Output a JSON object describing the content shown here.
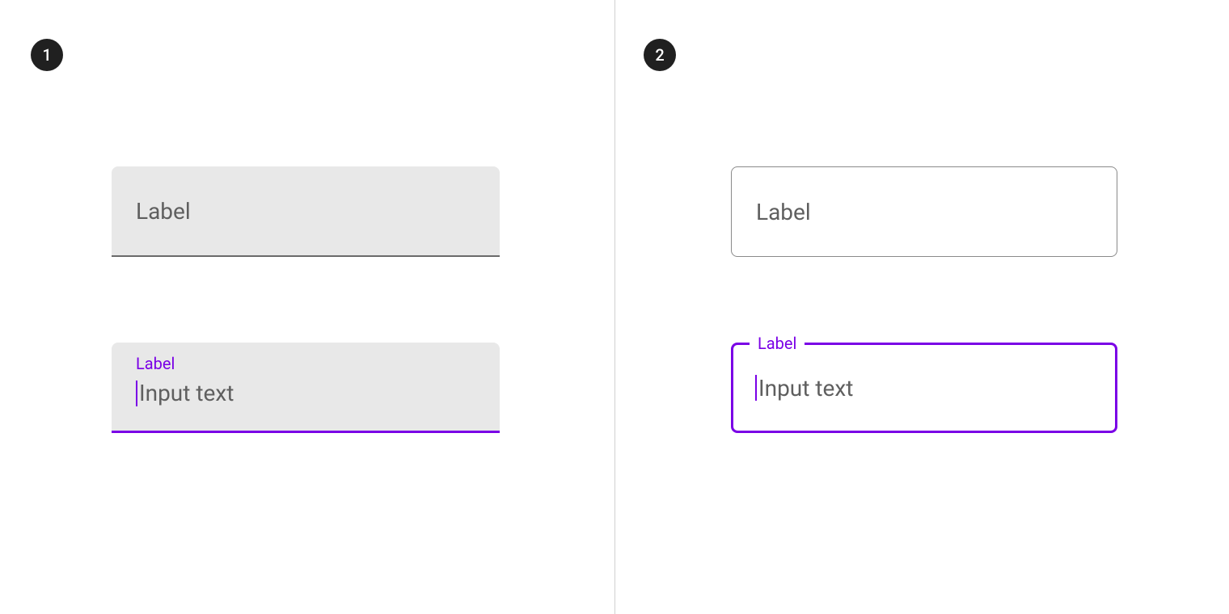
{
  "panels": {
    "left": {
      "badge": "1",
      "filled_inactive": {
        "label": "Label"
      },
      "filled_active": {
        "float_label": "Label",
        "placeholder": "Input text"
      }
    },
    "right": {
      "badge": "2",
      "outlined_inactive": {
        "label": "Label"
      },
      "outlined_active": {
        "float_label": "Label",
        "placeholder": "Input text"
      }
    }
  },
  "colors": {
    "accent": "#7a00e6",
    "fill": "#e8e8e8",
    "text_muted": "#5f5f5f",
    "badge_bg": "#202020"
  }
}
